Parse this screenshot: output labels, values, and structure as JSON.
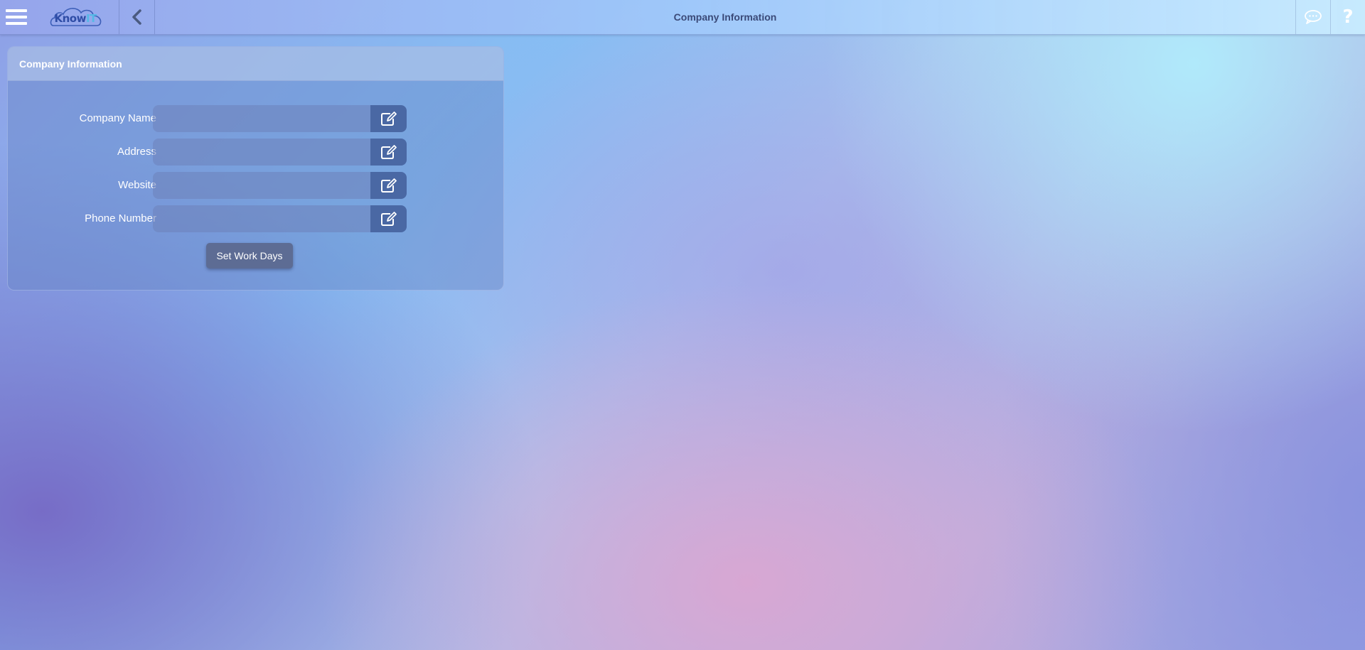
{
  "app": {
    "logo_text": "Know",
    "logo_text_accent": "IT",
    "page_title": "Company Information"
  },
  "icons": {
    "menu": "hamburger-icon",
    "back": "chevron-left-icon",
    "chat": "chat-bubble-icon",
    "help": "question-mark-icon",
    "help_glyph": "?",
    "edit": "edit-pencil-icon"
  },
  "panel": {
    "title": "Company Information",
    "fields": [
      {
        "label": "Company Name",
        "value": ""
      },
      {
        "label": "Address",
        "value": ""
      },
      {
        "label": "Website",
        "value": ""
      },
      {
        "label": "Phone Number",
        "value": ""
      }
    ],
    "set_work_days_label": "Set Work Days"
  },
  "colors": {
    "edit_button": "#4a68a4",
    "primary_button": "#5d6c94",
    "title_text": "#3b4a78"
  }
}
